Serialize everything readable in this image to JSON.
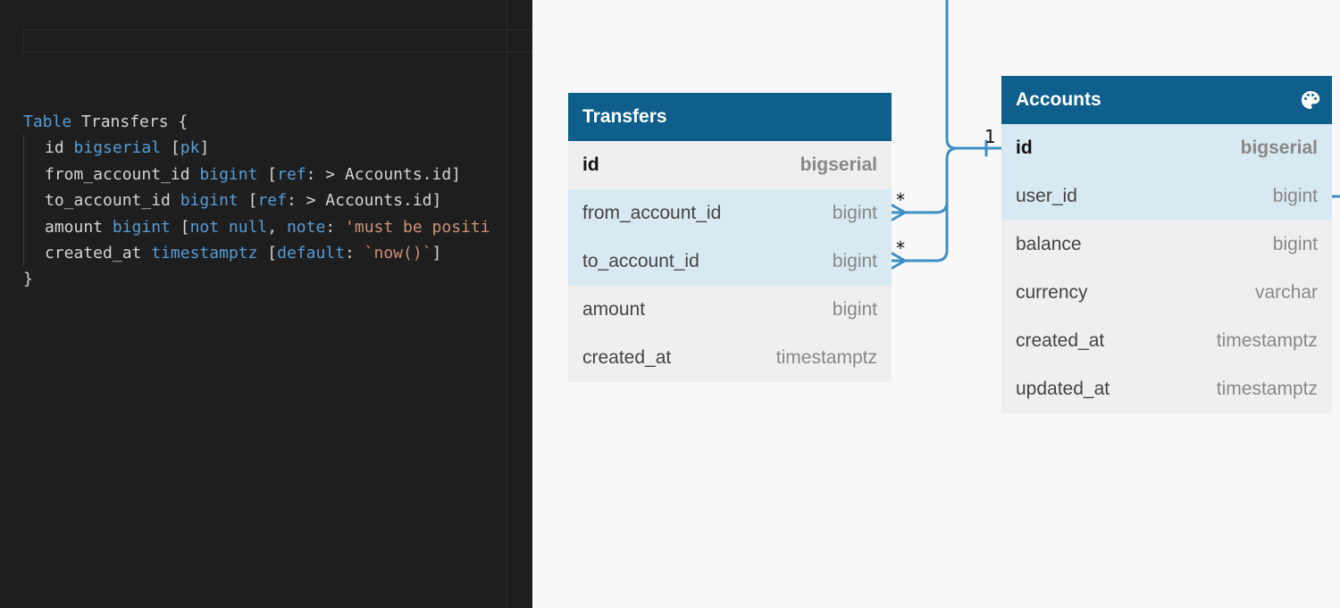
{
  "editor": {
    "lines": [
      [
        {
          "t": "Table",
          "c": "kw"
        },
        {
          "t": " Transfers {",
          "c": "plain"
        }
      ],
      [
        {
          "t": "id ",
          "c": "plain"
        },
        {
          "t": "bigserial",
          "c": "kw"
        },
        {
          "t": " [",
          "c": "plain"
        },
        {
          "t": "pk",
          "c": "kw"
        },
        {
          "t": "]",
          "c": "plain"
        }
      ],
      [
        {
          "t": "from_account_id ",
          "c": "plain"
        },
        {
          "t": "bigint",
          "c": "kw"
        },
        {
          "t": " [",
          "c": "plain"
        },
        {
          "t": "ref",
          "c": "kw"
        },
        {
          "t": ": > Accounts.id]",
          "c": "plain"
        }
      ],
      [
        {
          "t": "to_account_id ",
          "c": "plain"
        },
        {
          "t": "bigint",
          "c": "kw"
        },
        {
          "t": " [",
          "c": "plain"
        },
        {
          "t": "ref",
          "c": "kw"
        },
        {
          "t": ": > Accounts.id]",
          "c": "plain"
        }
      ],
      [
        {
          "t": "amount ",
          "c": "plain"
        },
        {
          "t": "bigint",
          "c": "kw"
        },
        {
          "t": " [",
          "c": "plain"
        },
        {
          "t": "not null",
          "c": "kw"
        },
        {
          "t": ", ",
          "c": "plain"
        },
        {
          "t": "note",
          "c": "kw"
        },
        {
          "t": ": ",
          "c": "plain"
        },
        {
          "t": "'must be positi",
          "c": "str"
        }
      ],
      [
        {
          "t": "created_at ",
          "c": "plain"
        },
        {
          "t": "timestamptz",
          "c": "kw"
        },
        {
          "t": " [",
          "c": "plain"
        },
        {
          "t": "default",
          "c": "kw"
        },
        {
          "t": ": ",
          "c": "plain"
        },
        {
          "t": "`now()`",
          "c": "str"
        },
        {
          "t": "]",
          "c": "plain"
        }
      ],
      [
        {
          "t": "}",
          "c": "plain"
        }
      ]
    ],
    "indented": [
      false,
      true,
      true,
      true,
      true,
      true,
      false
    ]
  },
  "colors": {
    "header": "#0e5f8c",
    "link": "#3d8fc4",
    "keyword": "#569cd6",
    "string": "#ce9178"
  },
  "transfers": {
    "title": "Transfers",
    "fields": [
      {
        "name": "id",
        "type": "bigserial",
        "pk": true,
        "highlight": false
      },
      {
        "name": "from_account_id",
        "type": "bigint",
        "pk": false,
        "highlight": true
      },
      {
        "name": "to_account_id",
        "type": "bigint",
        "pk": false,
        "highlight": true
      },
      {
        "name": "amount",
        "type": "bigint",
        "pk": false,
        "highlight": false
      },
      {
        "name": "created_at",
        "type": "timestamptz",
        "pk": false,
        "highlight": false
      }
    ]
  },
  "accounts": {
    "title": "Accounts",
    "icon": "palette-icon",
    "fields": [
      {
        "name": "id",
        "type": "bigserial",
        "pk": true,
        "highlight": true
      },
      {
        "name": "user_id",
        "type": "bigint",
        "pk": false,
        "highlight": true
      },
      {
        "name": "balance",
        "type": "bigint",
        "pk": false,
        "highlight": false
      },
      {
        "name": "currency",
        "type": "varchar",
        "pk": false,
        "highlight": false
      },
      {
        "name": "created_at",
        "type": "timestamptz",
        "pk": false,
        "highlight": false
      },
      {
        "name": "updated_at",
        "type": "timestamptz",
        "pk": false,
        "highlight": false
      }
    ]
  },
  "relations": {
    "many_label": "*",
    "one_label": "1"
  }
}
